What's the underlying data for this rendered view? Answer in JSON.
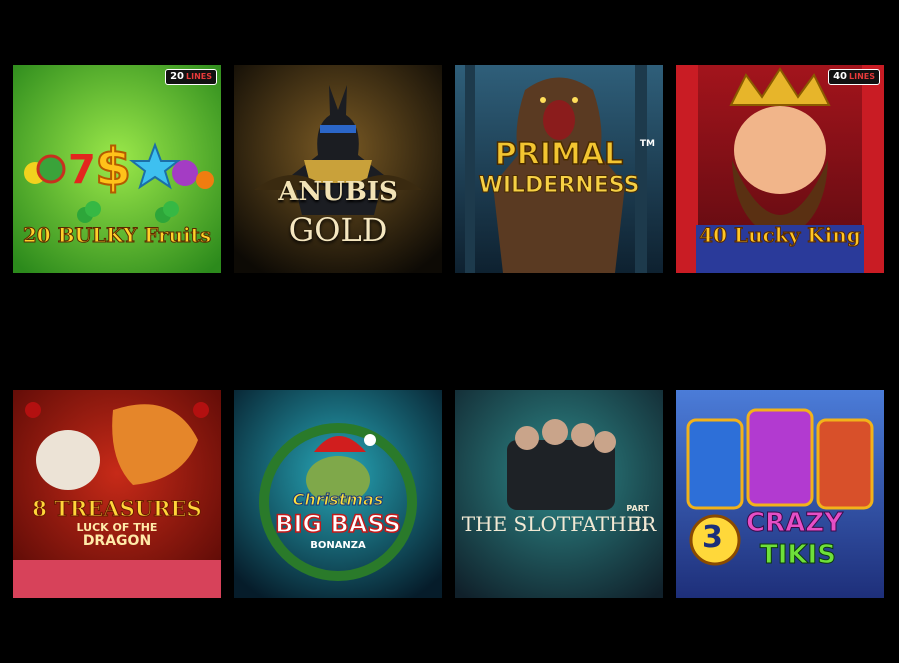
{
  "games": [
    {
      "title": "20 BULKY Fruits",
      "badge_num": "20",
      "badge_unit": "LINES"
    },
    {
      "title_line1": "ANUBIS",
      "title_line2": "GOLD"
    },
    {
      "title_line1": "PRIMAL",
      "title_line2": "WILDERNESS",
      "tm": "TM"
    },
    {
      "title": "40 Lucky King",
      "badge_num": "40",
      "badge_unit": "LINES"
    },
    {
      "title_line1": "8 TREASURES",
      "title_line2": "LUCK OF THE",
      "title_line3": "DRAGON"
    },
    {
      "title_line1": "Christmas",
      "title_line2": "BIG BASS",
      "title_line3": "BONANZA"
    },
    {
      "title": "THE SLOTFATHER",
      "part_label": "PART",
      "part_num": "II"
    },
    {
      "title_num": "3",
      "title_line1": "CRAZY",
      "title_line2": "TIKIS"
    }
  ],
  "colors": {
    "background": "#000000"
  }
}
